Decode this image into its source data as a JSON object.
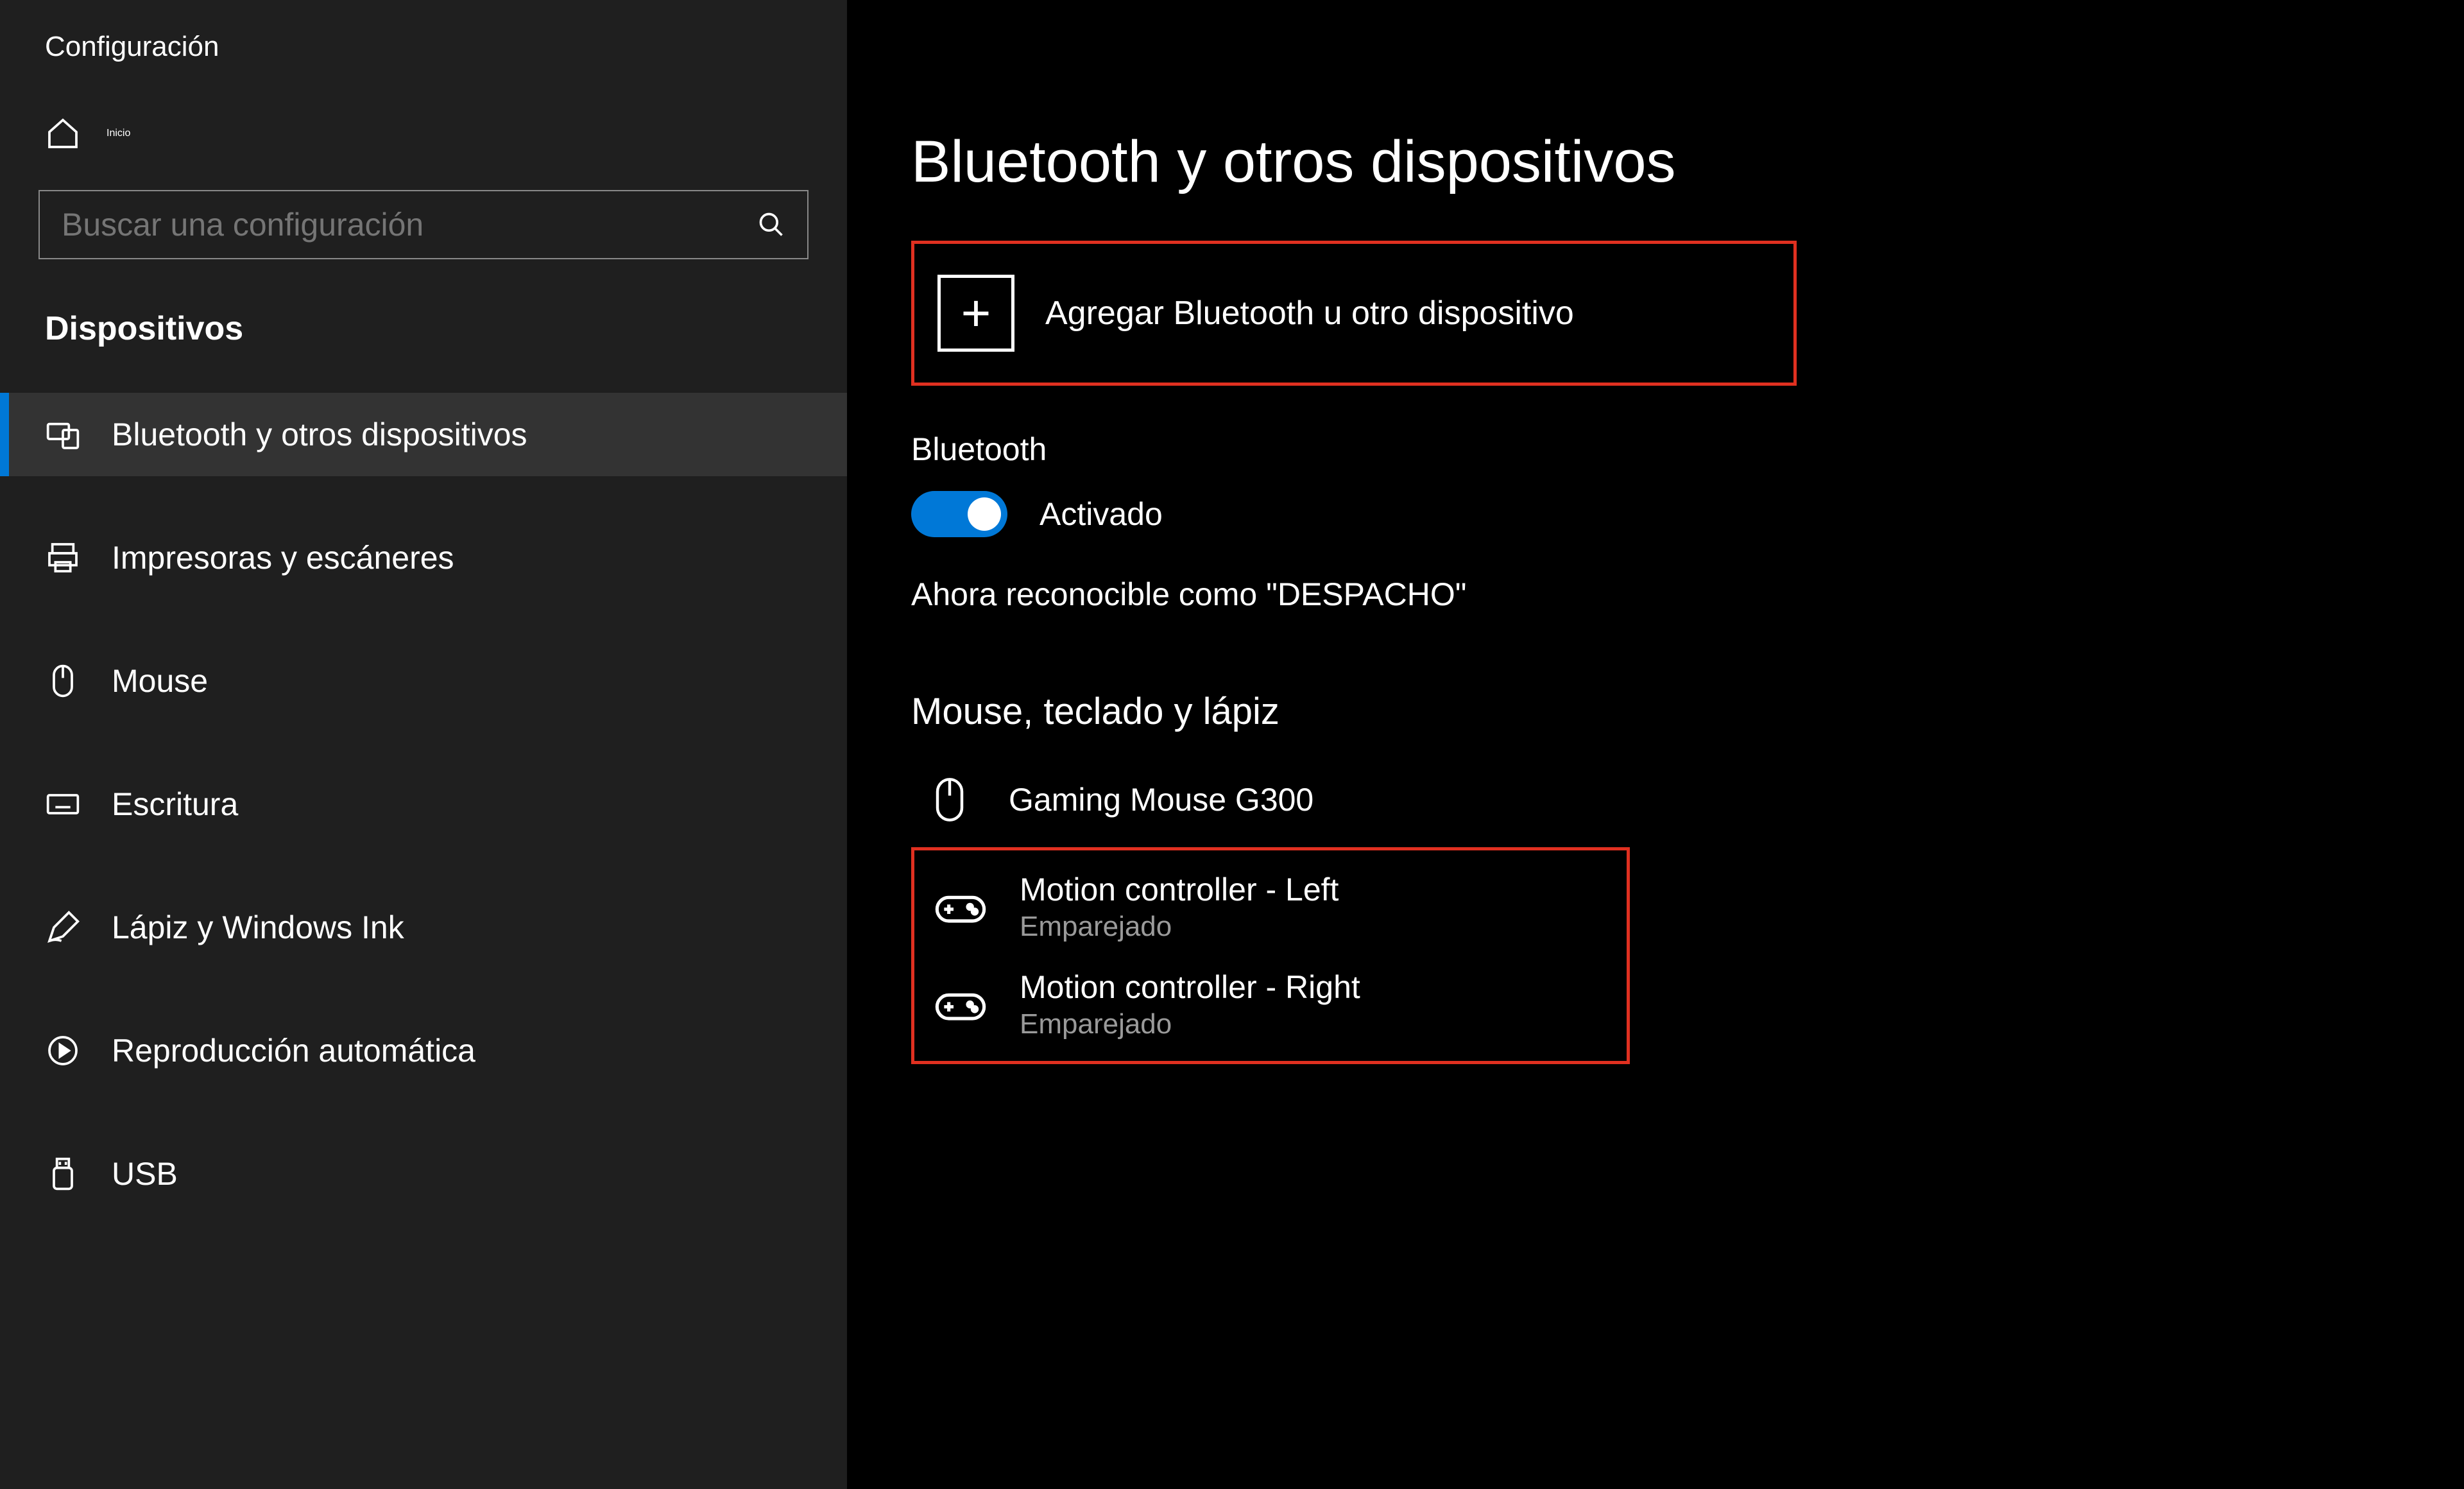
{
  "window_title": "Configuración",
  "home_label": "Inicio",
  "search_placeholder": "Buscar una configuración",
  "section_header": "Dispositivos",
  "nav": [
    {
      "label": "Bluetooth y otros dispositivos",
      "icon": "devices",
      "active": true
    },
    {
      "label": "Impresoras y escáneres",
      "icon": "printer",
      "active": false
    },
    {
      "label": "Mouse",
      "icon": "mouse",
      "active": false
    },
    {
      "label": "Escritura",
      "icon": "keyboard",
      "active": false
    },
    {
      "label": "Lápiz y Windows Ink",
      "icon": "pen",
      "active": false
    },
    {
      "label": "Reproducción automática",
      "icon": "autoplay",
      "active": false
    },
    {
      "label": "USB",
      "icon": "usb",
      "active": false
    }
  ],
  "page_title": "Bluetooth y otros dispositivos",
  "add_device_label": "Agregar Bluetooth u otro dispositivo",
  "bluetooth": {
    "heading": "Bluetooth",
    "state_label": "Activado",
    "discoverable_text": "Ahora reconocible como \"DESPACHO\""
  },
  "device_section_title": "Mouse, teclado y lápiz",
  "devices": [
    {
      "name": "Gaming Mouse G300",
      "status": "",
      "icon": "mouse"
    },
    {
      "name": "Motion controller - Left",
      "status": "Emparejado",
      "icon": "gamepad"
    },
    {
      "name": "Motion controller - Right",
      "status": "Emparejado",
      "icon": "gamepad"
    }
  ],
  "highlight_color": "#e03020",
  "accent_color": "#0078d7"
}
